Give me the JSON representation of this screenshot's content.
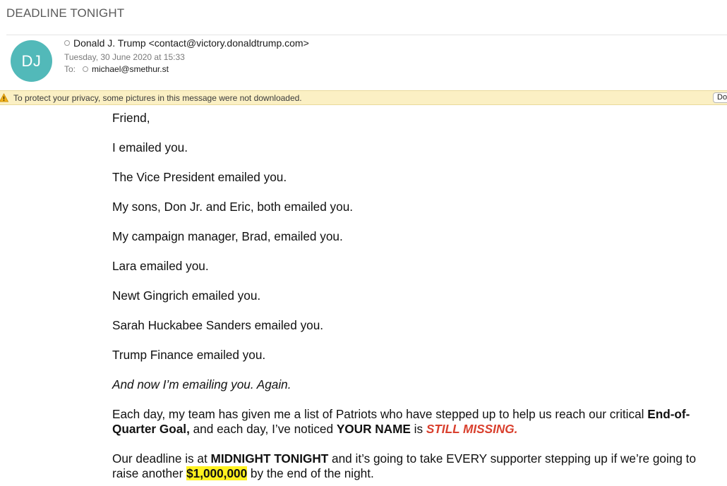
{
  "subject": "DEADLINE TONIGHT",
  "sender": {
    "initials": "DJ",
    "from": "Donald J. Trump <contact@victory.donaldtrump.com>",
    "date": "Tuesday, 30 June 2020 at 15:33",
    "to_label": "To:",
    "to": "michael@smethur.st",
    "avatar_color": "#52b9b9"
  },
  "banner": {
    "text": "To protect your privacy, some pictures in this message were not downloaded.",
    "button_label": "Do",
    "icon": "warning-icon"
  },
  "body": {
    "greeting": "Friend,",
    "lines": [
      "I emailed you.",
      "The Vice President emailed you.",
      "My sons, Don Jr. and Eric, both emailed you.",
      "My campaign manager, Brad, emailed you.",
      "Lara emailed you.",
      "Newt Gingrich emailed you.",
      "Sarah Huckabee Sanders emailed you.",
      "Trump Finance emailed you."
    ],
    "italic_line": "And now I’m emailing you. Again.",
    "para1": {
      "t1": "Each day, my team has given me a list of Patriots who have stepped up to help us reach our critical ",
      "b1": "End-of-Quarter Goal,",
      "t2": " and each day, I’ve noticed ",
      "b2": "YOUR NAME",
      "t3": " is ",
      "red": "STILL MISSING."
    },
    "para2": {
      "t1": "Our deadline is at ",
      "b1": "MIDNIGHT TONIGHT",
      "t2": " and it’s going to take EVERY supporter stepping up if we’re going to raise another ",
      "hl": "$1,000,000",
      "t3": " by the end of the night."
    }
  },
  "colors": {
    "red_text": "#d9402e",
    "highlight": "#fff21f",
    "banner_bg": "#fbf0c4"
  }
}
